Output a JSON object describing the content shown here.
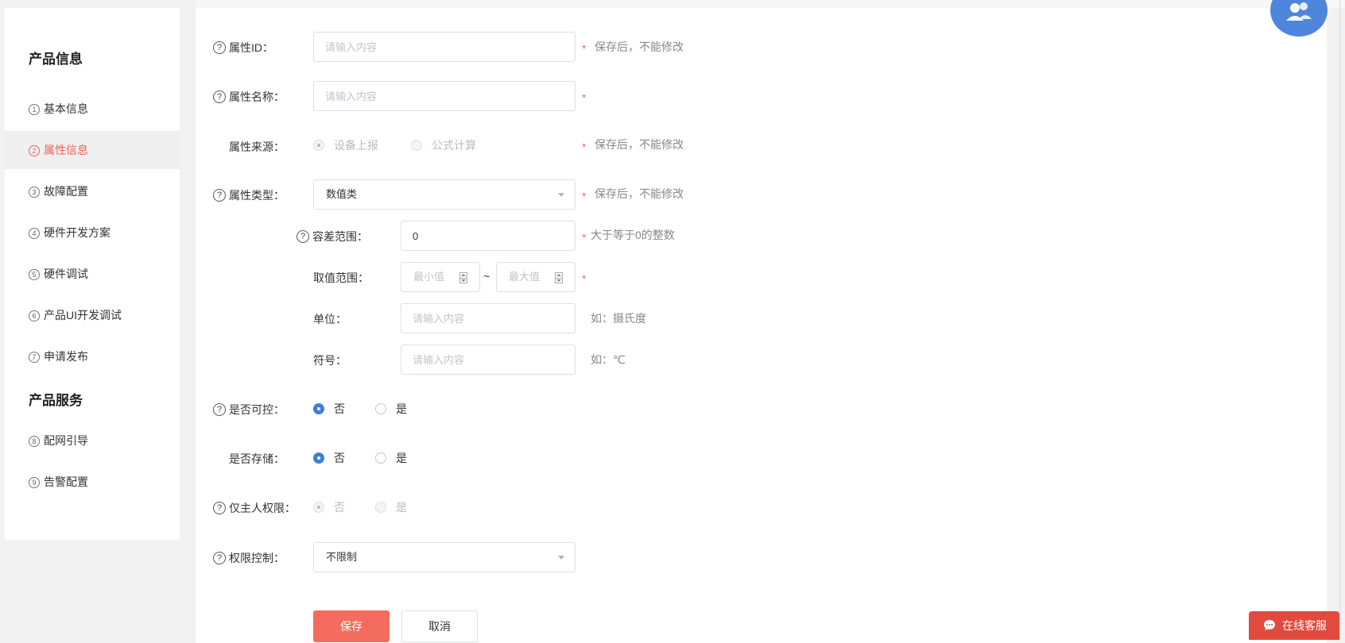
{
  "sidebar": {
    "product_info_heading": "产品信息",
    "product_service_heading": "产品服务",
    "items": [
      {
        "num": "1",
        "label": "基本信息"
      },
      {
        "num": "2",
        "label": "属性信息"
      },
      {
        "num": "3",
        "label": "故障配置"
      },
      {
        "num": "4",
        "label": "硬件开发方案"
      },
      {
        "num": "5",
        "label": "硬件调试"
      },
      {
        "num": "6",
        "label": "产品UI开发调试"
      },
      {
        "num": "7",
        "label": "申请发布"
      },
      {
        "num": "8",
        "label": "配网引导"
      },
      {
        "num": "9",
        "label": "告警配置"
      }
    ],
    "active_index": 1
  },
  "form": {
    "help_glyph": "?",
    "required_mark": "*",
    "attr_id": {
      "label": "属性ID：",
      "placeholder": "请输入内容",
      "hint": "保存后，不能修改"
    },
    "attr_name": {
      "label": "属性名称：",
      "placeholder": "请输入内容"
    },
    "attr_source": {
      "label": "属性来源：",
      "options": [
        "设备上报",
        "公式计算"
      ],
      "selected": "设备上报",
      "hint": "保存后，不能修改"
    },
    "attr_type": {
      "label": "属性类型：",
      "value": "数值类",
      "hint": "保存后，不能修改"
    },
    "tolerance": {
      "label": "容差范围：",
      "value": "0",
      "hint": "大于等于0的整数"
    },
    "value_range": {
      "label": "取值范围：",
      "min_placeholder": "最小值",
      "max_placeholder": "最大值",
      "separator": "~"
    },
    "unit": {
      "label": "单位：",
      "placeholder": "请输入内容",
      "hint": "如：摄氏度"
    },
    "symbol": {
      "label": "符号：",
      "placeholder": "请输入内容",
      "hint": "如：℃"
    },
    "controllable": {
      "label": "是否可控：",
      "options": [
        "否",
        "是"
      ],
      "selected": "否"
    },
    "storable": {
      "label": "是否存储：",
      "options": [
        "否",
        "是"
      ],
      "selected": "否"
    },
    "owner_only": {
      "label": "仅主人权限：",
      "options": [
        "否",
        "是"
      ],
      "selected": "否"
    },
    "permission": {
      "label": "权限控制：",
      "value": "不限制"
    },
    "save_label": "保存",
    "cancel_label": "取消"
  },
  "chat": {
    "label": "在线客服"
  },
  "colors": {
    "accent": "#f46c5e",
    "primary": "#4f86db",
    "required": "#f56c6c"
  }
}
